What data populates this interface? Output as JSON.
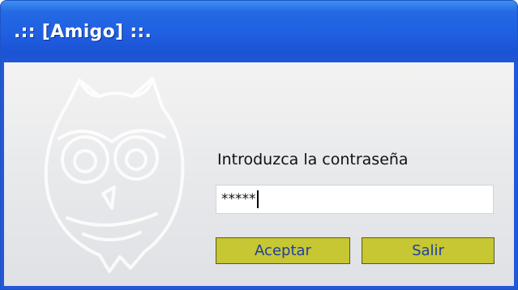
{
  "window": {
    "title": ".:: [Amigo] ::."
  },
  "login": {
    "prompt": "Introduzca la contraseña",
    "password_value": "*****"
  },
  "buttons": {
    "accept_label": "Aceptar",
    "exit_label": "Salir"
  },
  "icons": {
    "background": "owl-icon"
  },
  "colors": {
    "title_bar": "#1f5fe0",
    "client_bg": "#e9eaec",
    "button_bg": "#c6c732",
    "button_text": "#1e3ea8"
  }
}
